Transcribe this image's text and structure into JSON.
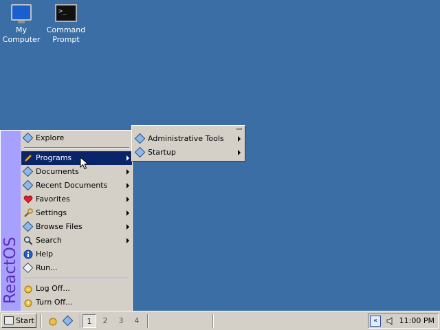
{
  "desktop": {
    "icons": [
      {
        "label_line1": "My",
        "label_line2": "Computer",
        "icon": "my-computer-icon"
      },
      {
        "label_line1": "Command",
        "label_line2": "Prompt",
        "icon": "command-prompt-icon"
      }
    ],
    "background_color": "#3a6ea5"
  },
  "start_menu": {
    "sidebar_label": "ReactOS",
    "items": [
      {
        "label": "Explore",
        "icon": "explore-icon"
      },
      {
        "label": "Programs",
        "icon": "pencil-icon",
        "selected": true
      },
      {
        "label": "Documents",
        "icon": "documents-icon"
      },
      {
        "label": "Recent Documents",
        "icon": "recent-documents-icon"
      },
      {
        "label": "Favorites",
        "icon": "heart-icon"
      },
      {
        "label": "Settings",
        "icon": "wrench-icon"
      },
      {
        "label": "Browse Files",
        "icon": "browse-files-icon"
      },
      {
        "label": "Search",
        "icon": "magnifier-icon"
      },
      {
        "label": "Help",
        "icon": "help-icon"
      },
      {
        "label": "Run...",
        "icon": "run-icon"
      },
      {
        "label": "Log Off...",
        "icon": "log-off-icon"
      },
      {
        "label": "Turn Off...",
        "icon": "turn-off-icon"
      }
    ]
  },
  "programs_submenu": {
    "items": [
      {
        "label": "Administrative Tools",
        "icon": "folder-icon"
      },
      {
        "label": "Startup",
        "icon": "folder-icon"
      }
    ]
  },
  "taskbar": {
    "start_label": "Start",
    "desktops": [
      "1",
      "2",
      "3",
      "4"
    ],
    "active_desktop": "1",
    "tray": {
      "collapse_glyph": "«",
      "clock": "11:00 PM"
    }
  },
  "colors": {
    "menu_background": "#d4d0c8",
    "selection": "#0a246a",
    "sidebar": "#a8a0ff",
    "sidebar_text": "#5c2fb8"
  }
}
